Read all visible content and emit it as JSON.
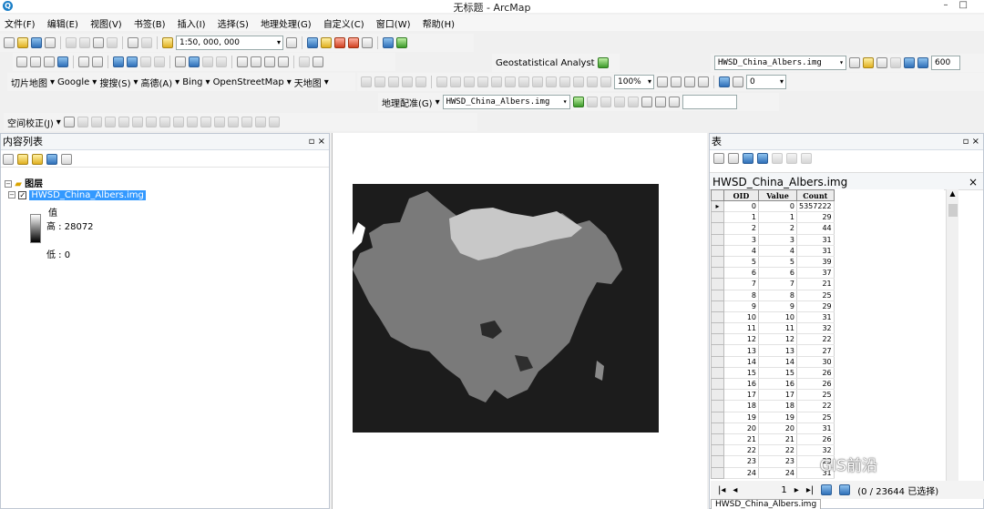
{
  "window": {
    "title": "无标题 - ArcMap",
    "app_icon": "arcmap-globe-icon"
  },
  "menu": [
    "文件(F)",
    "编辑(E)",
    "视图(V)",
    "书签(B)",
    "插入(I)",
    "选择(S)",
    "地理处理(G)",
    "自定义(C)",
    "窗口(W)",
    "帮助(H)"
  ],
  "toolbar1": {
    "scale": "1:50, 000, 000"
  },
  "toolbar2": {
    "geostat": "Geostatistical Analyst",
    "layer_combo": "HWSD_China_Albers.img",
    "value": "600"
  },
  "toolbar3": {
    "labels": [
      "切片地图",
      "Google",
      "搜搜(S)",
      "高德(A)",
      "Bing",
      "OpenStreetMap",
      "天地图"
    ],
    "zoom": "100%",
    "spin": "0"
  },
  "toolbar4": {
    "georef": "地理配准(G)",
    "layer_combo": "HWSD_China_Albers.img"
  },
  "toolbar5": {
    "spatial_adj": "空间校正(J)"
  },
  "toc": {
    "title": "内容列表",
    "layers_root": "图层",
    "layer": "HWSD_China_Albers.img",
    "legend_label": "值",
    "high": "高 : 28072",
    "low": "低 : 0"
  },
  "table": {
    "panel_title": "表",
    "table_title": "HWSD_China_Albers.img",
    "columns": [
      "OID",
      "Value",
      "Count"
    ],
    "rows": [
      [
        0,
        0,
        5357222
      ],
      [
        1,
        1,
        29
      ],
      [
        2,
        2,
        44
      ],
      [
        3,
        3,
        31
      ],
      [
        4,
        4,
        31
      ],
      [
        5,
        5,
        39
      ],
      [
        6,
        6,
        37
      ],
      [
        7,
        7,
        21
      ],
      [
        8,
        8,
        25
      ],
      [
        9,
        9,
        29
      ],
      [
        10,
        10,
        31
      ],
      [
        11,
        11,
        32
      ],
      [
        12,
        12,
        22
      ],
      [
        13,
        13,
        27
      ],
      [
        14,
        14,
        30
      ],
      [
        15,
        15,
        26
      ],
      [
        16,
        16,
        26
      ],
      [
        17,
        17,
        25
      ],
      [
        18,
        18,
        22
      ],
      [
        19,
        19,
        25
      ],
      [
        20,
        20,
        31
      ],
      [
        21,
        21,
        26
      ],
      [
        22,
        22,
        32
      ],
      [
        23,
        23,
        23
      ],
      [
        24,
        24,
        31
      ]
    ],
    "nav_record": "1",
    "selection_status": "(0 / 23644 已选择)",
    "bottom_tab": "HWSD_China_Albers.img"
  },
  "watermark": "GIS前沿",
  "colors": {
    "selection": "#3399ff",
    "map_dark": "#1c1c1c",
    "china": "#7a7a7a",
    "mongolia": "#c8c8c8"
  }
}
